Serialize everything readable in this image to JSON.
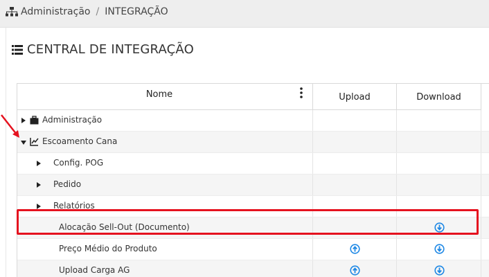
{
  "breadcrumb": {
    "section": "Administração",
    "page": "INTEGRAÇÃO",
    "separator": "/"
  },
  "panel_title": "CENTRAL DE INTEGRAÇÃO",
  "table": {
    "columns": {
      "name": "Nome",
      "upload": "Upload",
      "download": "Download"
    },
    "rows": [
      {
        "label": "Administração",
        "level": 0,
        "expand": "collapsed",
        "icon": "briefcase-icon",
        "upload": false,
        "download": false
      },
      {
        "label": "Escoamento Cana",
        "level": 0,
        "expand": "expanded",
        "icon": "line-chart-icon",
        "upload": false,
        "download": false
      },
      {
        "label": "Config. POG",
        "level": 1,
        "expand": "collapsed",
        "upload": false,
        "download": false
      },
      {
        "label": "Pedido",
        "level": 1,
        "expand": "collapsed",
        "upload": false,
        "download": false
      },
      {
        "label": "Relatórios",
        "level": 1,
        "expand": "collapsed",
        "upload": false,
        "download": false
      },
      {
        "label": "Alocação Sell-Out (Documento)",
        "level": 2,
        "upload": false,
        "download": true,
        "highlighted": true
      },
      {
        "label": "Preço Médio do Produto",
        "level": 2,
        "upload": true,
        "download": true
      },
      {
        "label": "Upload Carga AG",
        "level": 2,
        "upload": true,
        "download": true
      }
    ]
  },
  "colors": {
    "accent_blue": "#1e88e5",
    "highlight_red": "#e5121f",
    "topbar": "#eeeeee"
  }
}
